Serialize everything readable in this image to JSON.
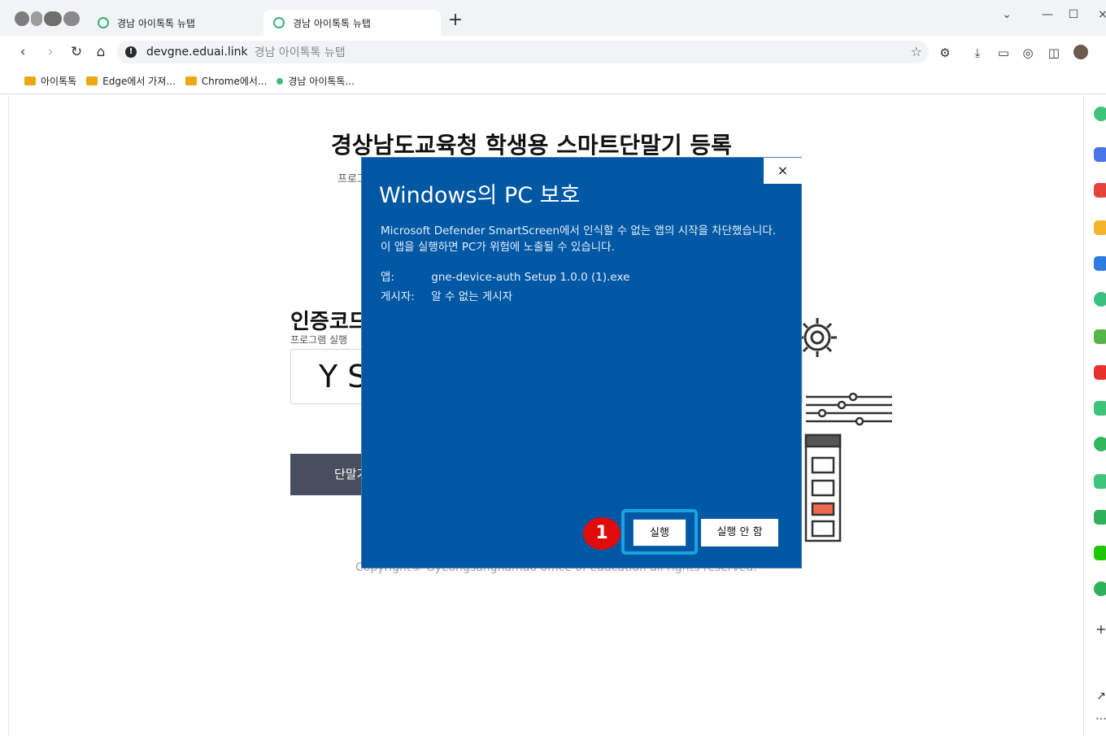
{
  "browser": {
    "logo_text": "아이톡톡",
    "tabs": [
      {
        "label": "경남 아이톡톡 뉴탭",
        "active": false
      },
      {
        "label": "경남 아이톡톡 뉴탭",
        "active": true
      }
    ],
    "new_tab_symbol": "+",
    "address": {
      "domain": "devgne.eduai.link",
      "page_title": "경남 아이톡톡 뉴탭"
    },
    "bookmarks": [
      {
        "label": "아이톡톡",
        "icon": "folder-icon"
      },
      {
        "label": "Edge에서 가져...",
        "icon": "folder-icon"
      },
      {
        "label": "Chrome에서...",
        "icon": "folder-icon"
      },
      {
        "label": "경남 아이톡톡...",
        "icon": "site-dot-icon"
      }
    ]
  },
  "page": {
    "heading": "경상남도교육청 학생용 스마트단말기 등록",
    "subtext_visible": "프로그",
    "auth_label_visible": "인증코드",
    "auth_sub_visible": "프로그램 실행",
    "code_visible": "Y S",
    "button_visible": "단말기",
    "copyright_visible": "Copyright© Gyeongsangnamdo office of education all rights reserved."
  },
  "dialog": {
    "title": "Windows의 PC 보호",
    "message": "Microsoft Defender SmartScreen에서 인식할 수 없는 앱의 시작을 차단했습니다. 이 앱을 실행하면 PC가 위험에 노출될 수 있습니다.",
    "app_key": "앱:",
    "app_value": "gne-device-auth Setup 1.0.0 (1).exe",
    "publisher_key": "게시자:",
    "publisher_value": "알 수 없는 게시자",
    "run_label": "실행",
    "dont_run_label": "실행 안 함",
    "close_symbol": "×"
  },
  "annotation": {
    "step_number": "1"
  },
  "colors": {
    "dialog_bg": "#0057a3",
    "highlight": "#1aa3e0",
    "badge": "#e00c0c",
    "tab_ring": "#3bb27a"
  }
}
